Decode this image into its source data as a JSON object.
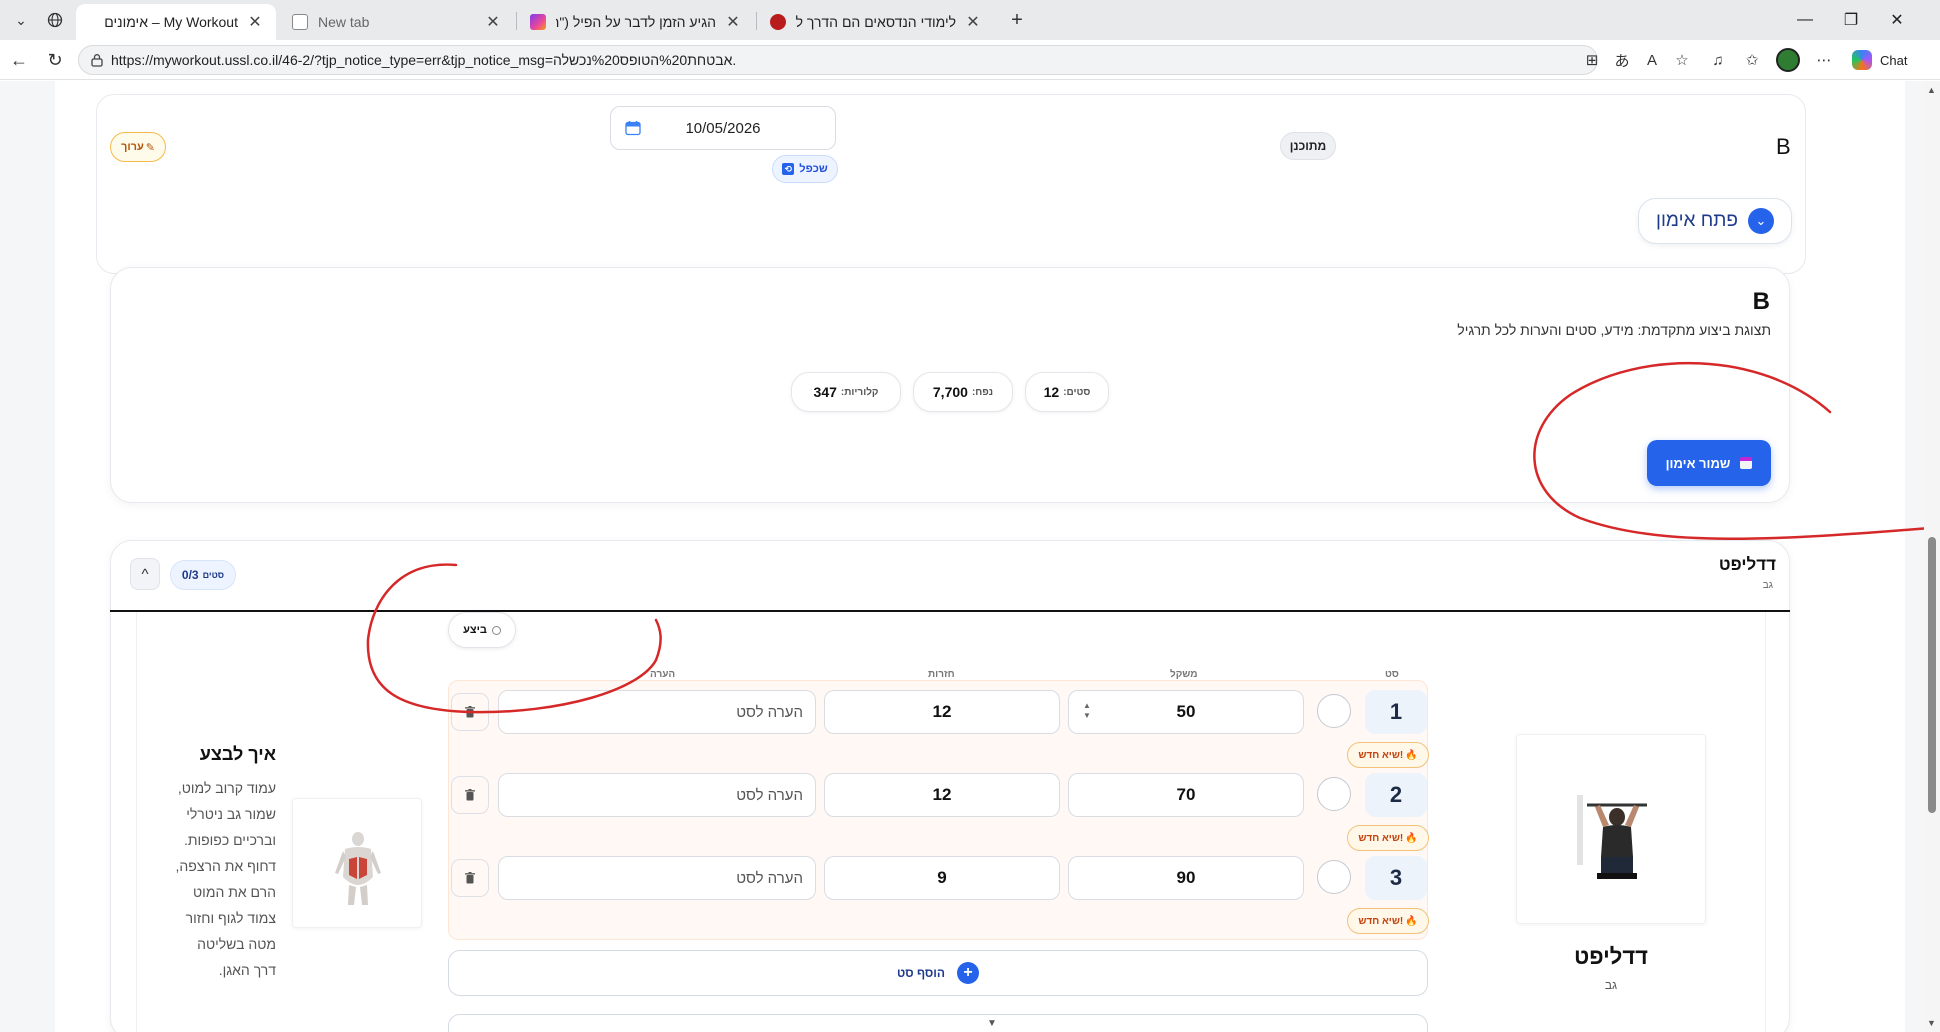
{
  "browser": {
    "tabs": [
      {
        "label": "My Workout – אימונים",
        "active": true
      },
      {
        "label": "New tab",
        "active": false
      },
      {
        "label": "הגיע הזמן לדבר על הפיל (\"הזקן\") ש",
        "active": false
      },
      {
        "label": "לימודי הנדסאים הם הדרך להצלחה!!",
        "active": false
      }
    ],
    "url": "https://myworkout.ussl.co.il/46-2/?tjp_notice_type=err&tjp_notice_msg=אבטחת%20הטופס%20נכשלה.",
    "chat_label": "Chat"
  },
  "workout": {
    "letter": "B",
    "status": "מתוכנן",
    "date": "10/05/2026",
    "repeat_label": "שכפל",
    "edit_label": "ערוך",
    "open_label": "פתח אימון"
  },
  "summary": {
    "title": "B",
    "subtitle": "תצוגת ביצוע מתקדמת: מידע, סטים והערות לכל תרגיל",
    "stats": [
      {
        "label": "סטים:",
        "value": "12"
      },
      {
        "label": "נפח:",
        "value": "7,700"
      },
      {
        "label": "קלוריות:",
        "value": "347"
      }
    ],
    "save_label": "שמור אימון"
  },
  "exercise": {
    "name": "דדליפט",
    "muscle": "גב",
    "progress": "0/3",
    "progress_unit": "סטים",
    "collapse_glyph": "^",
    "done_label": "ביצע",
    "columns": {
      "set": "סט",
      "weight": "משקל",
      "reps": "חזרות",
      "note": "הערה"
    },
    "note_placeholder": "הערה לסט",
    "new_badge": "שיא חדש!",
    "sets": [
      {
        "num": "1",
        "weight": "50",
        "reps": "12"
      },
      {
        "num": "2",
        "weight": "70",
        "reps": "12"
      },
      {
        "num": "3",
        "weight": "90",
        "reps": "9"
      }
    ],
    "add_set_label": "הוסף סט",
    "how_to_title": "איך לבצע",
    "how_to_lines": [
      "עמוד קרוב למוט,",
      "שמור גב ניטרלי",
      "וברכיים כפופות.",
      "דחוף את הרצפה,",
      "הרם את המוט",
      "צמוד לגוף וחזור",
      "מטה בשליטה",
      "דרך האגן."
    ],
    "image_title": "דדליפט",
    "image_subtitle": "גב"
  },
  "colors": {
    "accent": "#2563eb",
    "annotation": "#d62828",
    "new_badge": "#c2410c"
  }
}
